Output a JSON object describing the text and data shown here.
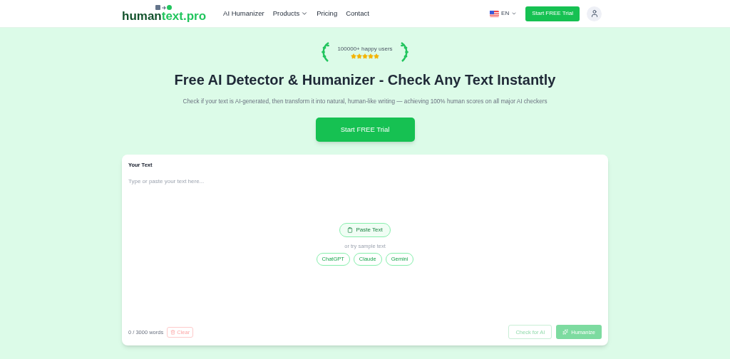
{
  "nav": {
    "logo": {
      "main": "human",
      "accent": "text.pro"
    },
    "links": [
      {
        "label": "AI Humanizer",
        "dropdown": false
      },
      {
        "label": "Products",
        "dropdown": true
      },
      {
        "label": "Pricing",
        "dropdown": false
      },
      {
        "label": "Contact",
        "dropdown": false
      }
    ],
    "language": "EN",
    "cta": "Start FREE Trial"
  },
  "hero": {
    "badge": {
      "text": "100000+ happy users",
      "stars": 5
    },
    "title": "Free AI Detector & Humanizer - Check Any Text Instantly",
    "subtitle": "Check if your text is AI-generated, then transform it into natural, human-like writing — achieving 100% human scores on all major AI checkers",
    "cta": "Start FREE Trial"
  },
  "editor": {
    "label": "Your Text",
    "placeholder": "Type or paste your text here...",
    "paste_button": "Paste Text",
    "sample_hint": "or try sample text",
    "samples": [
      "ChatGPT",
      "Claude",
      "Gemini"
    ],
    "word_count": "0 / 3000 words",
    "clear": "Clear",
    "actions": [
      {
        "label": "Check for AI",
        "kind": "outline",
        "disabled": true
      },
      {
        "label": "Humanize",
        "kind": "solid",
        "disabled": true
      }
    ]
  }
}
